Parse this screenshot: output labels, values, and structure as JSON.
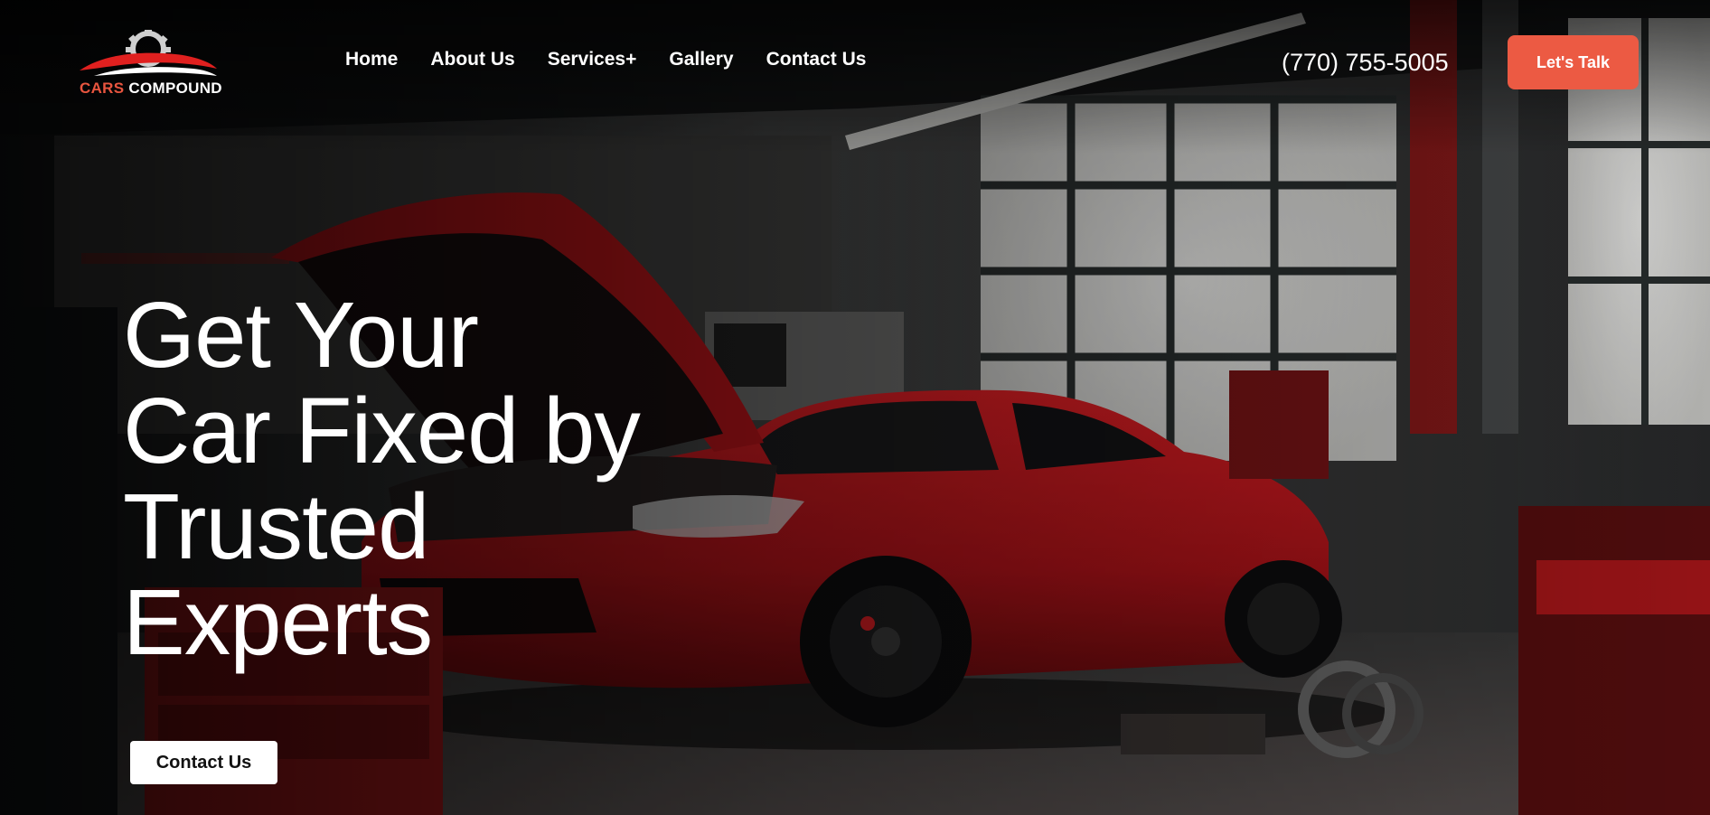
{
  "header": {
    "logo": {
      "text_part1": "CARS",
      "text_part2": "COMPOUND"
    },
    "nav": [
      "Home",
      "About Us",
      "Services+",
      "Gallery",
      "Contact Us"
    ],
    "phone": "(770) 755-5005",
    "cta_label": "Let's Talk"
  },
  "hero": {
    "headline_lines": [
      "Get Your",
      "Car Fixed by",
      "Trusted",
      "Experts"
    ],
    "cta_label": "Contact Us",
    "background": "red-sports-car-in-garage-photo"
  },
  "colors": {
    "accent": "#ec5a43",
    "car_red": "#c8161a",
    "background": "#151515",
    "text": "#ffffff"
  }
}
